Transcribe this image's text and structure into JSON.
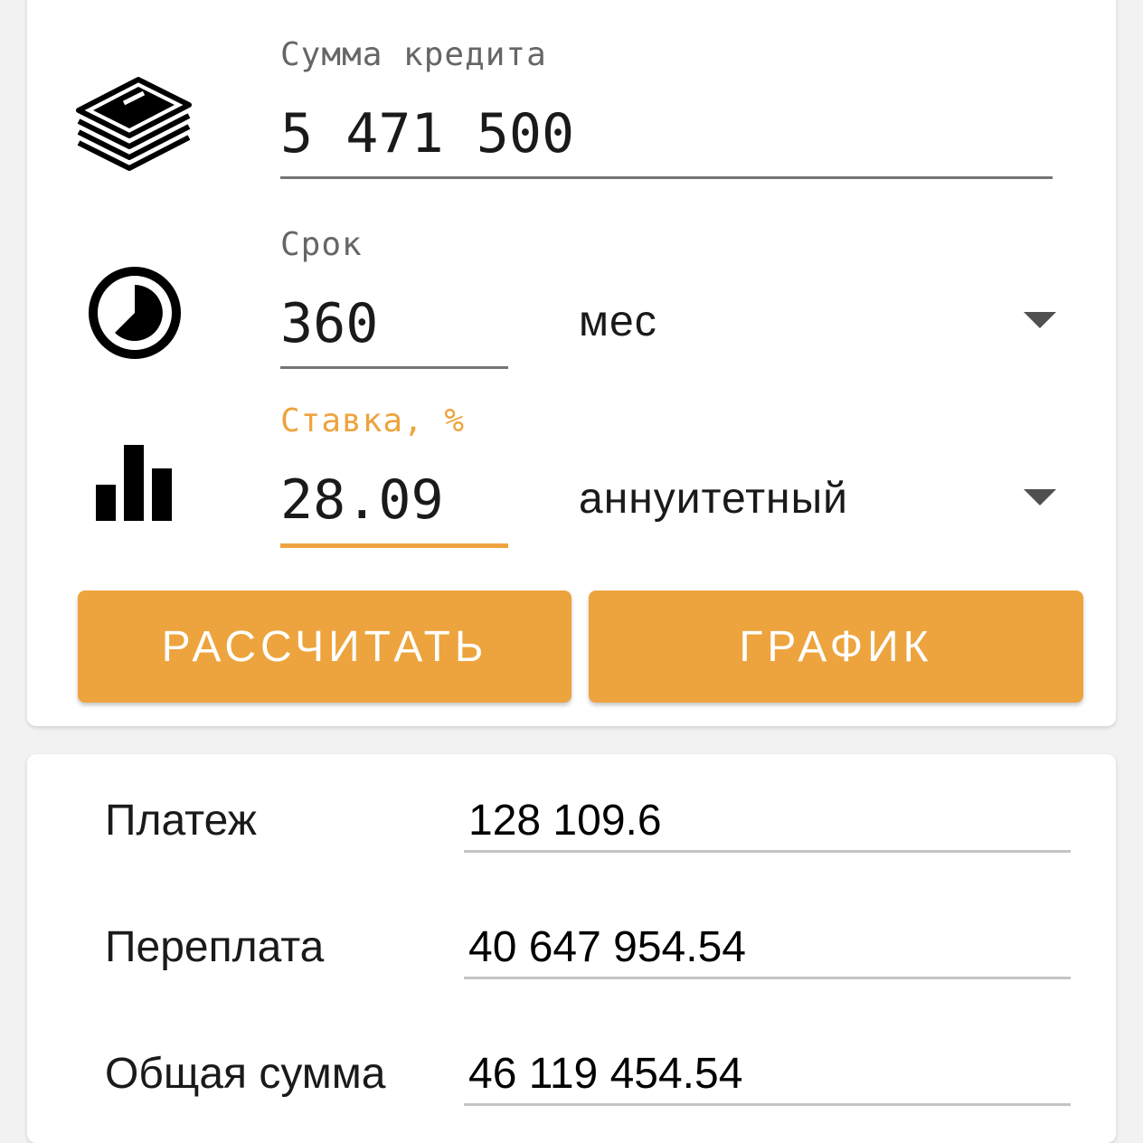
{
  "loan": {
    "amount_label": "Сумма кредита",
    "amount_value": "5 471 500",
    "amount_icon": "money-stack-icon"
  },
  "term": {
    "label": "Срок",
    "value": "360",
    "unit": "мес",
    "icon": "clock-icon"
  },
  "rate": {
    "label": "Ставка, %",
    "value": "28.09",
    "payment_type": "аннуитетный",
    "icon": "bar-chart-icon"
  },
  "actions": {
    "calculate_label": "РАССЧИТАТЬ",
    "schedule_label": "ГРАФИК"
  },
  "results": {
    "payment_label": "Платеж",
    "payment_value": "128 109.6",
    "overpayment_label": "Переплата",
    "overpayment_value": "40 647 954.54",
    "total_label": "Общая сумма",
    "total_value": "46 119 454.54"
  },
  "colors": {
    "accent": "#eda43e",
    "background": "#f2f2f2",
    "card": "#ffffff"
  }
}
